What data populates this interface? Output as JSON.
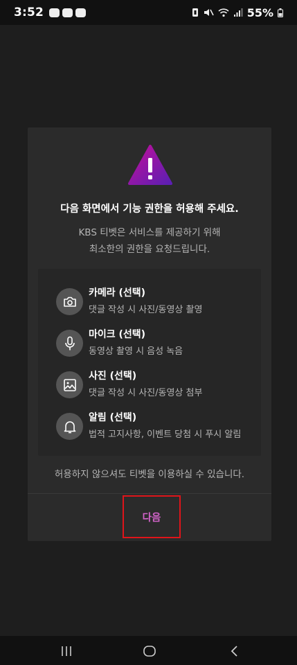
{
  "status_bar": {
    "time": "3:52",
    "battery": "55%"
  },
  "dialog": {
    "icon": "warning-icon",
    "title": "다음 화면에서 기능 권한을 허용해 주세요.",
    "subtitle_line1": "KBS 티벳은 서비스를 제공하기 위해",
    "subtitle_line2": "최소한의 권한을 요청드립니다.",
    "permissions": [
      {
        "icon": "camera-icon",
        "name": "카메라 (선택)",
        "desc": "댓글 작성 시 사진/동영상 촬영"
      },
      {
        "icon": "microphone-icon",
        "name": "마이크 (선택)",
        "desc": "동영상 촬영 시 음성 녹음"
      },
      {
        "icon": "photo-icon",
        "name": "사진 (선택)",
        "desc": "댓글 작성 시 사진/동영상 첨부"
      },
      {
        "icon": "bell-icon",
        "name": "알림 (선택)",
        "desc": "법적 고지사항, 이벤트 당첨 시 푸시 알림"
      }
    ],
    "note": "허용하지 않으셔도 티벳을 이용하실 수 있습니다.",
    "next_label": "다음"
  },
  "colors": {
    "accent": "#d263c9",
    "highlight_border": "#e0141a",
    "warning_gradient_start": "#c2109a",
    "warning_gradient_end": "#5b1fb3"
  }
}
